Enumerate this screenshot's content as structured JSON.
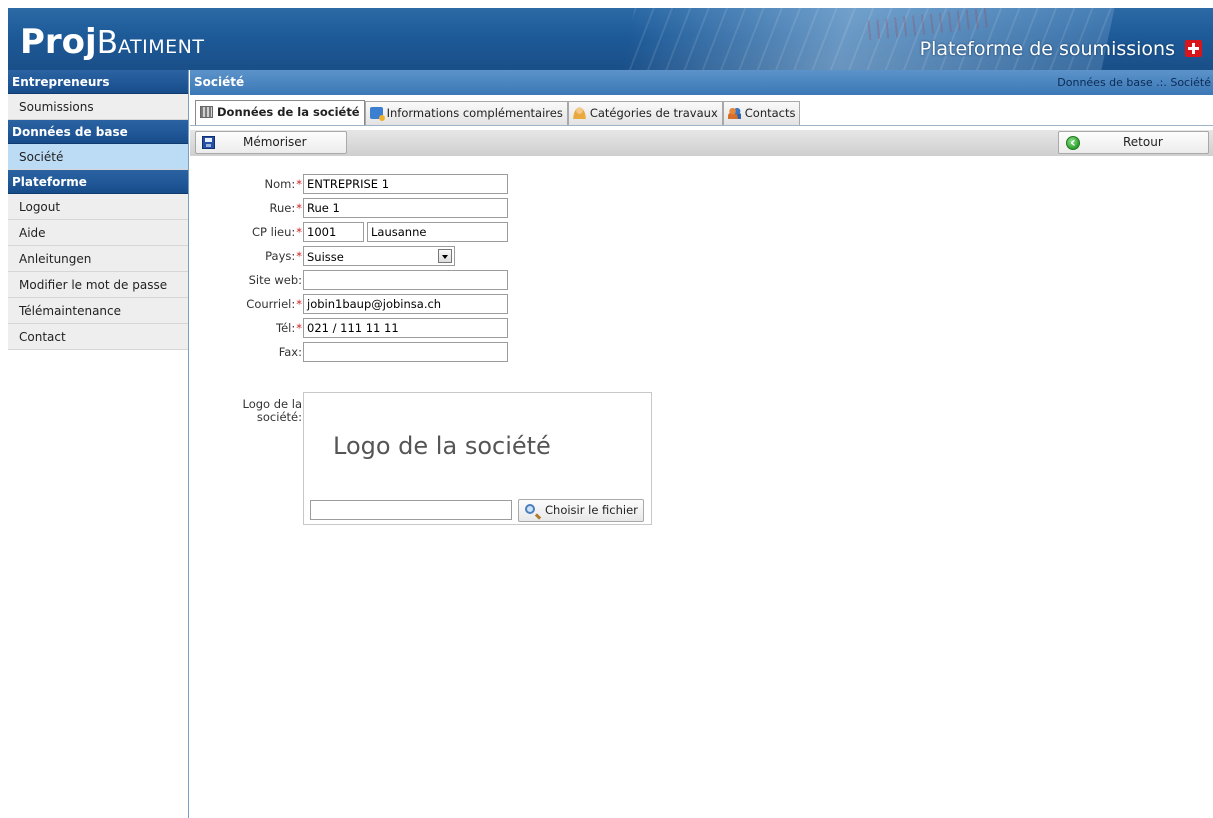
{
  "header": {
    "brand_proj": "Proj",
    "brand_b": "B",
    "brand_atiment": "ATIMENT",
    "platform_title": "Plateforme de soumissions",
    "flag_icon": "swiss-flag-icon"
  },
  "sidebar": {
    "sections": [
      {
        "title": "Entrepreneurs",
        "items": [
          {
            "label": "Soumissions",
            "active": false
          }
        ]
      },
      {
        "title": "Données de base",
        "items": [
          {
            "label": "Société",
            "active": true
          }
        ]
      },
      {
        "title": "Plateforme",
        "items": [
          {
            "label": "Logout",
            "active": false
          },
          {
            "label": "Aide",
            "active": false
          },
          {
            "label": "Anleitungen",
            "active": false
          },
          {
            "label": "Modifier le mot de passe",
            "active": false
          },
          {
            "label": "Télémaintenance",
            "active": false
          },
          {
            "label": "Contact",
            "active": false
          }
        ]
      }
    ]
  },
  "page": {
    "title": "Société",
    "breadcrumb": "Données de base .:. Société"
  },
  "tabs": [
    {
      "label": "Données de la société",
      "icon": "building-icon",
      "active": true
    },
    {
      "label": "Informations complémentaires",
      "icon": "info-icon",
      "active": false
    },
    {
      "label": "Catégories de travaux",
      "icon": "person-icon",
      "active": false
    },
    {
      "label": "Contacts",
      "icon": "contacts-icon",
      "active": false
    }
  ],
  "toolbar": {
    "save_label": "Mémoriser",
    "back_label": "Retour"
  },
  "form": {
    "nom": {
      "label": "Nom:",
      "required": true,
      "value": "ENTREPRISE 1"
    },
    "rue": {
      "label": "Rue:",
      "required": true,
      "value": "Rue 1"
    },
    "cp_lieu": {
      "label": "CP lieu:",
      "required": true,
      "cp_value": "1001",
      "lieu_value": "Lausanne"
    },
    "pays": {
      "label": "Pays:",
      "required": true,
      "value": "Suisse"
    },
    "site_web": {
      "label": "Site web:",
      "required": false,
      "value": ""
    },
    "courriel": {
      "label": "Courriel:",
      "required": true,
      "value": "jobin1baup@jobinsa.ch"
    },
    "tel": {
      "label": "Tél:",
      "required": true,
      "value": "021 / 111 11 11"
    },
    "fax": {
      "label": "Fax:",
      "required": false,
      "value": ""
    },
    "required_marker": "*"
  },
  "logo": {
    "label_line1": "Logo de la",
    "label_line2": "société:",
    "placeholder": "Logo de la société",
    "file_value": "",
    "choose_label": "Choisir le fichier"
  },
  "colors": {
    "header_blue": "#1d5a98",
    "sidebar_head": "#184d8c",
    "active_item": "#bcdcf6",
    "required_red": "#d01a1a"
  }
}
